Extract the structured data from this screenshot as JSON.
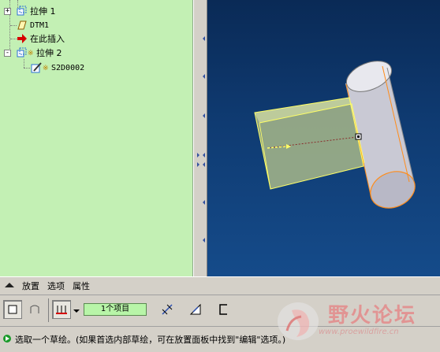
{
  "model_tree": {
    "items": [
      {
        "label": "拉伸 1",
        "icon": "extrude-feature-icon",
        "expander": "+"
      },
      {
        "label": "DTM1",
        "icon": "datum-plane-icon"
      },
      {
        "label": "在此插入",
        "icon": "insert-here-arrow-icon"
      },
      {
        "label": "拉伸 2",
        "icon": "extrude-feature-icon",
        "expander": "-"
      },
      {
        "label": "S2D0002",
        "icon": "sketch-icon"
      }
    ]
  },
  "dashboard": {
    "tabs": [
      "放置",
      "选项",
      "属性"
    ],
    "collector_label": "1个项目"
  },
  "status": {
    "message": "选取一个草绘。(如果首选内部草绘，可在放置面板中找到\"编辑\"选项。)"
  },
  "watermark": {
    "title": "野火论坛",
    "url": "www.proewildfire.cn"
  },
  "colors": {
    "tree_bg": "#c3f0b4",
    "graphics_bg": "#0f3b72",
    "highlight": "#ffff66",
    "edge_orange": "#ff8c1a"
  }
}
